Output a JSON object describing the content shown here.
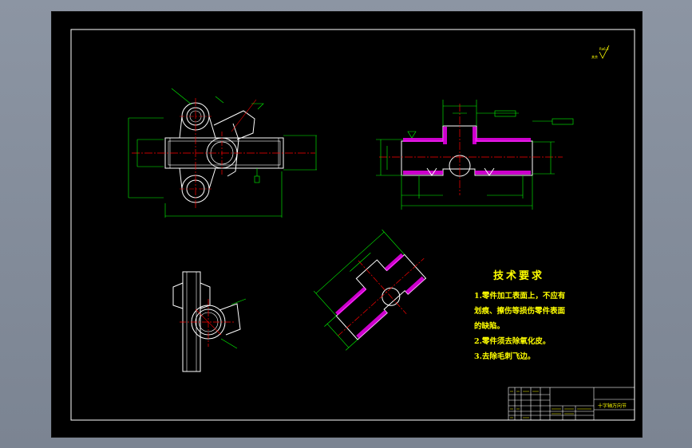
{
  "notes": {
    "title": "技术要求",
    "lines": [
      "1.零件加工表面上，不应有",
      "划痕、擦伤等损伤零件表面",
      "的缺陷。",
      "2.零件须去除氧化皮。",
      "3.去除毛刺飞边。"
    ]
  },
  "roughness": {
    "symbol": "Ra6.3",
    "note": "其余"
  },
  "title_block": {
    "part_name": "十字轴万向节"
  },
  "colors": {
    "sheet": "#000000",
    "outline": "#ffffff",
    "center_line": "#ff0000",
    "dimension": "#00ff00",
    "text": "#ffff00",
    "section_fill": "#ff00ff"
  }
}
